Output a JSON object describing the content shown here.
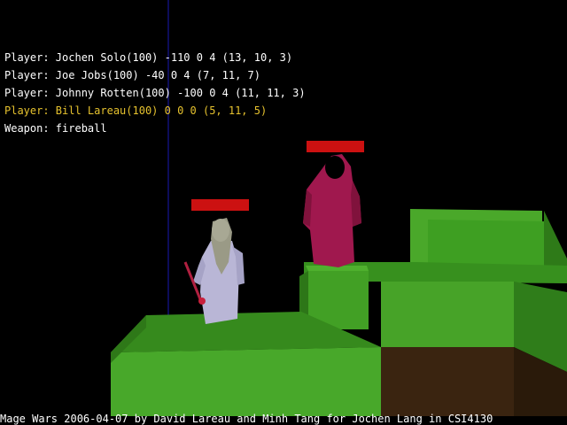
{
  "hud": {
    "players": [
      {
        "text": "Player: Jochen Solo(100) -110 0 4 (13, 10, 3)",
        "active": false
      },
      {
        "text": "Player: Joe Jobs(100) -40 0 4 (7, 11, 7)",
        "active": false
      },
      {
        "text": "Player: Johnny Rotten(100) -100 0 4 (11, 11, 3)",
        "active": false
      },
      {
        "text": "Player: Bill Lareau(100) 0 0 0 (5, 11, 5)",
        "active": true
      }
    ],
    "weapon": "Weapon: fireball"
  },
  "credits": "Mage Wars 2006-04-07 by David Lareau and Minh Tang for Jochen Lang in CSI4130",
  "colors": {
    "active_player": "#e6c22e",
    "health_bar": "#cc1111",
    "grass": "#4aa82a",
    "dirt": "#3a2410",
    "mage_white": "#b9b6d6",
    "mage_red": "#a0184e"
  },
  "scene": {
    "mages": [
      {
        "robe": "white",
        "health": 1.0
      },
      {
        "robe": "red",
        "health": 1.0
      }
    ]
  }
}
